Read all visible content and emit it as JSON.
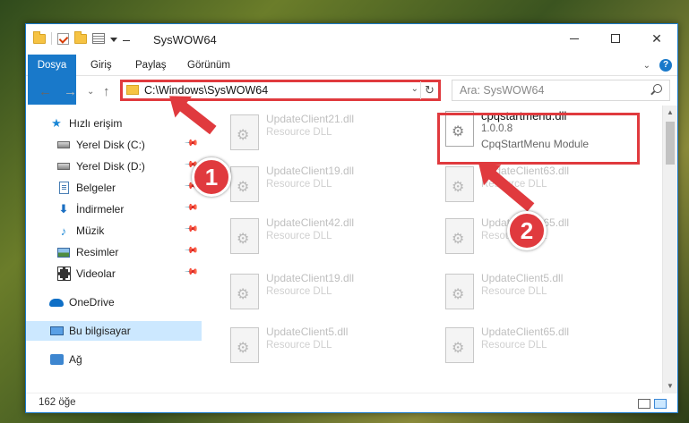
{
  "window": {
    "title": "SysWOW64"
  },
  "ribbon": {
    "tabs": [
      "Dosya",
      "Giriş",
      "Paylaş",
      "Görünüm"
    ]
  },
  "navbar": {
    "address": "C:\\Windows\\SysWOW64",
    "search_placeholder": "Ara: SysWOW64"
  },
  "sidebar": {
    "items": [
      {
        "label": "Hızlı erişim",
        "icon": "star-icon"
      },
      {
        "label": "Yerel Disk (C:)",
        "icon": "drive-icon",
        "pinned": true
      },
      {
        "label": "Yerel Disk (D:)",
        "icon": "drive-icon",
        "pinned": true
      },
      {
        "label": "Belgeler",
        "icon": "documents-icon",
        "pinned": true
      },
      {
        "label": "İndirmeler",
        "icon": "download-icon",
        "pinned": true
      },
      {
        "label": "Müzik",
        "icon": "music-icon",
        "pinned": true
      },
      {
        "label": "Resimler",
        "icon": "pictures-icon",
        "pinned": true
      },
      {
        "label": "Videolar",
        "icon": "videos-icon",
        "pinned": true
      },
      {
        "label": "OneDrive",
        "icon": "cloud-icon"
      },
      {
        "label": "Bu bilgisayar",
        "icon": "computer-icon",
        "selected": true
      },
      {
        "label": "Ağ",
        "icon": "network-icon"
      }
    ]
  },
  "files": {
    "left_column": [
      {
        "name": "UpdateClient21.dll",
        "desc": "Resource DLL"
      },
      {
        "name": "UpdateClient19.dll",
        "desc": "Resource DLL"
      },
      {
        "name": "UpdateClient42.dll",
        "desc": "Resource DLL"
      },
      {
        "name": "UpdateClient19.dll",
        "desc": "Resource DLL"
      },
      {
        "name": "UpdateClient5.dll",
        "desc": "Resource DLL"
      }
    ],
    "highlighted": {
      "name": "cpqstartmenu.dll",
      "version": "1.0.0.8",
      "desc": "CpqStartMenu Module"
    },
    "right_column": [
      {
        "name": "UpdateClient63.dll",
        "desc": "Resource DLL"
      },
      {
        "name": "UpdateClient65.dll",
        "desc": "Resource DLL"
      },
      {
        "name": "UpdateClient5.dll",
        "desc": "Resource DLL"
      },
      {
        "name": "UpdateClient65.dll",
        "desc": "Resource DLL"
      }
    ]
  },
  "status": {
    "item_count": "162 öğe"
  },
  "callouts": {
    "one": "1",
    "two": "2"
  },
  "colors": {
    "accent": "#1979ca",
    "callout": "#e03a3e",
    "selection": "#cce8ff"
  }
}
